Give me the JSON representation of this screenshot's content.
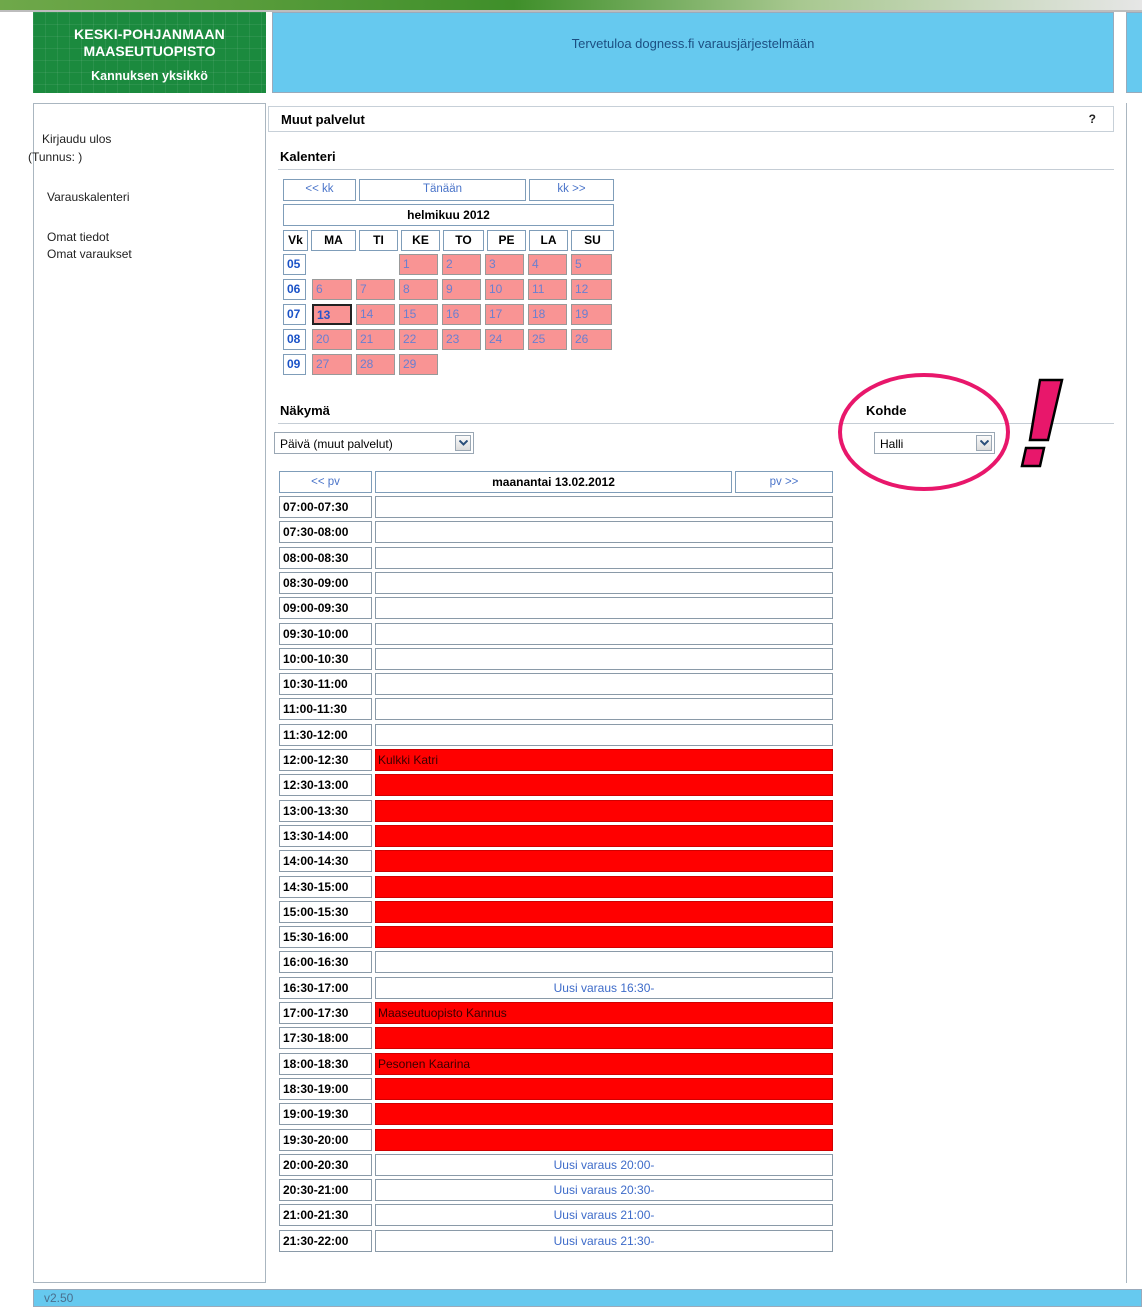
{
  "logo": {
    "line1": "KESKI-POHJANMAAN",
    "line2": "MAASEUTUOPISTO",
    "line3": "Kannuksen yksikkö"
  },
  "header": {
    "title": "Tervetuloa dogness.fi varausjärjestelmään"
  },
  "sidebar": {
    "logout": "Kirjaudu ulos",
    "user": "(Tunnus: )",
    "calendar": "Varauskalenteri",
    "my_info": "Omat tiedot",
    "my_bookings": "Omat varaukset"
  },
  "section": {
    "title": "Muut palvelut",
    "help": "?"
  },
  "calendar": {
    "label": "Kalenteri",
    "prev": "<< kk",
    "today": "Tänään",
    "next": "kk >>",
    "month": "helmikuu 2012",
    "headers": [
      "Vk",
      "MA",
      "TI",
      "KE",
      "TO",
      "PE",
      "LA",
      "SU"
    ],
    "weeks": [
      {
        "wk": "05",
        "days": [
          "",
          "",
          "1",
          "2",
          "3",
          "4",
          "5"
        ]
      },
      {
        "wk": "06",
        "days": [
          "6",
          "7",
          "8",
          "9",
          "10",
          "11",
          "12"
        ]
      },
      {
        "wk": "07",
        "days": [
          "13",
          "14",
          "15",
          "16",
          "17",
          "18",
          "19"
        ]
      },
      {
        "wk": "08",
        "days": [
          "20",
          "21",
          "22",
          "23",
          "24",
          "25",
          "26"
        ]
      },
      {
        "wk": "09",
        "days": [
          "27",
          "28",
          "29",
          "",
          "",
          "",
          ""
        ]
      }
    ],
    "selected_day": "13",
    "colors": {
      "day_bg": "#f99494",
      "link": "#4a74c9"
    }
  },
  "view": {
    "label": "Näkymä",
    "selected": "Päivä (muut palvelut)"
  },
  "target": {
    "label": "Kohde",
    "selected": "Halli"
  },
  "annotation": {
    "mark": "!",
    "color": "#e8176b"
  },
  "schedule": {
    "prev": "<< pv",
    "date": "maanantai 13.02.2012",
    "next": "pv >>",
    "booked_color": "#ff0000",
    "rows": [
      {
        "time": "07:00-07:30",
        "state": "empty",
        "text": ""
      },
      {
        "time": "07:30-08:00",
        "state": "empty",
        "text": ""
      },
      {
        "time": "08:00-08:30",
        "state": "empty",
        "text": ""
      },
      {
        "time": "08:30-09:00",
        "state": "empty",
        "text": ""
      },
      {
        "time": "09:00-09:30",
        "state": "empty",
        "text": ""
      },
      {
        "time": "09:30-10:00",
        "state": "empty",
        "text": ""
      },
      {
        "time": "10:00-10:30",
        "state": "empty",
        "text": ""
      },
      {
        "time": "10:30-11:00",
        "state": "empty",
        "text": ""
      },
      {
        "time": "11:00-11:30",
        "state": "empty",
        "text": ""
      },
      {
        "time": "11:30-12:00",
        "state": "empty",
        "text": ""
      },
      {
        "time": "12:00-12:30",
        "state": "booked",
        "text": "Kulkki Katri"
      },
      {
        "time": "12:30-13:00",
        "state": "booked",
        "text": ""
      },
      {
        "time": "13:00-13:30",
        "state": "booked",
        "text": ""
      },
      {
        "time": "13:30-14:00",
        "state": "booked",
        "text": ""
      },
      {
        "time": "14:00-14:30",
        "state": "booked",
        "text": ""
      },
      {
        "time": "14:30-15:00",
        "state": "booked",
        "text": ""
      },
      {
        "time": "15:00-15:30",
        "state": "booked",
        "text": ""
      },
      {
        "time": "15:30-16:00",
        "state": "booked",
        "text": ""
      },
      {
        "time": "16:00-16:30",
        "state": "empty",
        "text": ""
      },
      {
        "time": "16:30-17:00",
        "state": "free",
        "text": "Uusi varaus 16:30-"
      },
      {
        "time": "17:00-17:30",
        "state": "booked",
        "text": "Maaseutuopisto Kannus"
      },
      {
        "time": "17:30-18:00",
        "state": "booked",
        "text": ""
      },
      {
        "time": "18:00-18:30",
        "state": "booked",
        "text": "Pesonen Kaarina"
      },
      {
        "time": "18:30-19:00",
        "state": "booked",
        "text": ""
      },
      {
        "time": "19:00-19:30",
        "state": "booked",
        "text": ""
      },
      {
        "time": "19:30-20:00",
        "state": "booked",
        "text": ""
      },
      {
        "time": "20:00-20:30",
        "state": "free",
        "text": "Uusi varaus 20:00-"
      },
      {
        "time": "20:30-21:00",
        "state": "free",
        "text": "Uusi varaus 20:30-"
      },
      {
        "time": "21:00-21:30",
        "state": "free",
        "text": "Uusi varaus 21:00-"
      },
      {
        "time": "21:30-22:00",
        "state": "free",
        "text": "Uusi varaus 21:30-"
      }
    ]
  },
  "footer": {
    "version": "v2.50"
  }
}
